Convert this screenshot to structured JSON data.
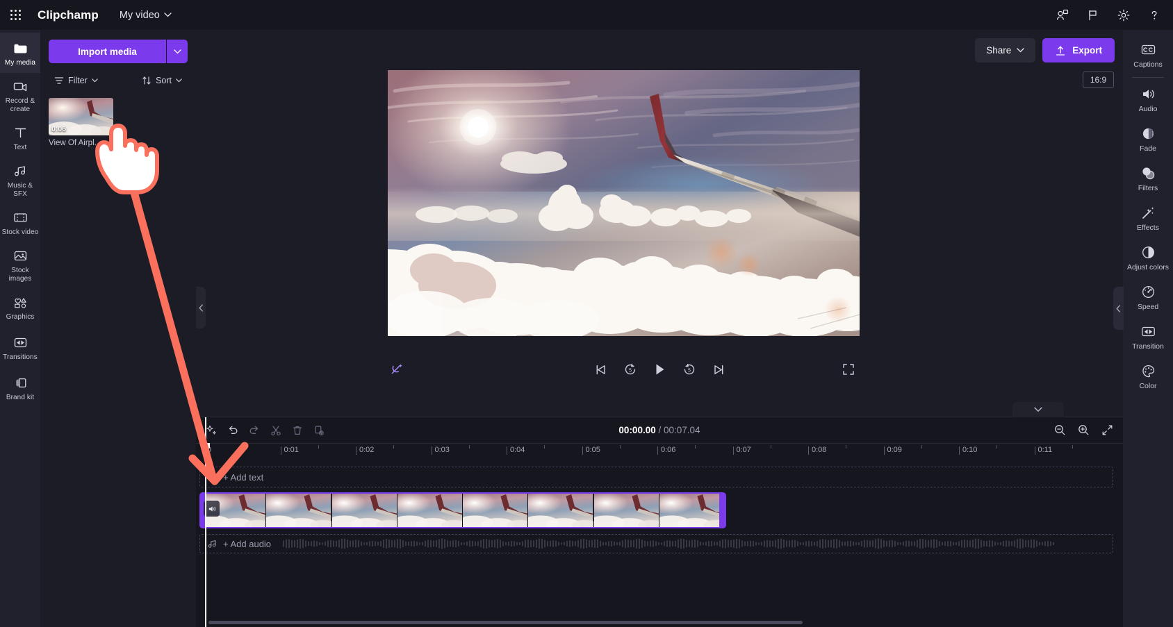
{
  "app": {
    "brand": "Clipchamp",
    "project_name": "My video",
    "accent_color": "#7c3aed",
    "annotation_color": "#fb6f5d"
  },
  "topbar": {
    "waffle_icon": "app-launcher-icon",
    "icons": [
      {
        "name": "collaborate-icon",
        "label": "Collaborate"
      },
      {
        "name": "feedback-flag-icon",
        "label": "Feedback"
      },
      {
        "name": "settings-gear-icon",
        "label": "Settings"
      },
      {
        "name": "help-question-icon",
        "label": "Help"
      }
    ]
  },
  "left_rail": {
    "items": [
      {
        "label": "My media",
        "icon": "folder-icon",
        "active": true
      },
      {
        "label": "Record & create",
        "icon": "video-camera-icon",
        "active": false
      },
      {
        "label": "Text",
        "icon": "text-t-icon",
        "active": false
      },
      {
        "label": "Music & SFX",
        "icon": "music-note-icon",
        "active": false
      },
      {
        "label": "Stock video",
        "icon": "film-strip-icon",
        "active": false
      },
      {
        "label": "Stock images",
        "icon": "picture-icon",
        "active": false
      },
      {
        "label": "Graphics",
        "icon": "shapes-icon",
        "active": false
      },
      {
        "label": "Transitions",
        "icon": "transition-icon",
        "active": false
      },
      {
        "label": "Brand kit",
        "icon": "brand-kit-icon",
        "active": false
      }
    ]
  },
  "media_panel": {
    "import_label": "Import media",
    "import_caret_icon": "chevron-down-icon",
    "filter_label": "Filter",
    "filter_icon": "filter-icon",
    "sort_label": "Sort",
    "sort_icon": "sort-arrows-icon",
    "items": [
      {
        "name": "View Of Airpl...",
        "duration": "0:06"
      }
    ]
  },
  "stage": {
    "share_label": "Share",
    "share_caret_icon": "chevron-down-icon",
    "export_label": "Export",
    "export_icon": "upload-arrow-icon",
    "aspect_ratio": "16:9",
    "collapse_left_icon": "chevron-left-icon",
    "collapse_right_icon": "chevron-left-icon"
  },
  "player": {
    "autocompose_icon": "magic-wand-crossed-icon",
    "controls": [
      {
        "name": "skip-to-start-button",
        "icon": "skip-previous-icon"
      },
      {
        "name": "rewind-5s-button",
        "icon": "rewind-5-icon",
        "label": "5"
      },
      {
        "name": "play-button",
        "icon": "play-icon"
      },
      {
        "name": "forward-5s-button",
        "icon": "forward-5-icon",
        "label": "5"
      },
      {
        "name": "skip-to-end-button",
        "icon": "skip-next-icon"
      }
    ],
    "fullscreen_icon": "fullscreen-icon"
  },
  "property_rail": {
    "items": [
      {
        "label": "Captions",
        "icon": "captions-cc-icon"
      },
      {
        "label": "Audio",
        "icon": "speaker-icon",
        "sep_before": true
      },
      {
        "label": "Fade",
        "icon": "fade-icon"
      },
      {
        "label": "Filters",
        "icon": "filters-circles-icon"
      },
      {
        "label": "Effects",
        "icon": "effects-wand-icon"
      },
      {
        "label": "Adjust colors",
        "icon": "adjust-colors-icon"
      },
      {
        "label": "Speed",
        "icon": "speedometer-icon"
      },
      {
        "label": "Transition",
        "icon": "transition-icon"
      },
      {
        "label": "Color",
        "icon": "color-palette-icon"
      }
    ]
  },
  "timeline": {
    "tools": [
      {
        "name": "auto-compose-button",
        "icon": "sparkles-icon"
      },
      {
        "name": "undo-button",
        "icon": "undo-arrow-icon"
      },
      {
        "name": "redo-button",
        "icon": "redo-arrow-icon"
      },
      {
        "name": "split-button",
        "icon": "scissors-icon"
      },
      {
        "name": "delete-button",
        "icon": "trash-icon"
      },
      {
        "name": "duplicate-button",
        "icon": "duplicate-icon"
      }
    ],
    "current_time": "00:00.00",
    "separator": "/",
    "total_time": "00:07.04",
    "zoom_controls": [
      {
        "name": "zoom-out-button",
        "icon": "magnifier-minus-icon"
      },
      {
        "name": "zoom-in-button",
        "icon": "magnifier-plus-icon"
      },
      {
        "name": "fit-to-screen-button",
        "icon": "fit-screen-icon"
      }
    ],
    "collapse_icon": "chevron-down-icon",
    "ruler_ticks": [
      "0",
      "0:01",
      "0:02",
      "0:03",
      "0:04",
      "0:05",
      "0:06",
      "0:07",
      "0:08",
      "0:09",
      "0:10",
      "0:11"
    ],
    "text_track": {
      "hint": "+ Add text",
      "icon": "text-t-icon"
    },
    "audio_track": {
      "hint": "+ Add audio",
      "icon": "music-note-icon"
    },
    "video_clip": {
      "mute_icon": "speaker-icon",
      "frame_count": 8
    }
  },
  "annotations": {
    "cursor_icon": "pointing-hand-cursor",
    "arrow_icon": "arrow-annotation"
  }
}
